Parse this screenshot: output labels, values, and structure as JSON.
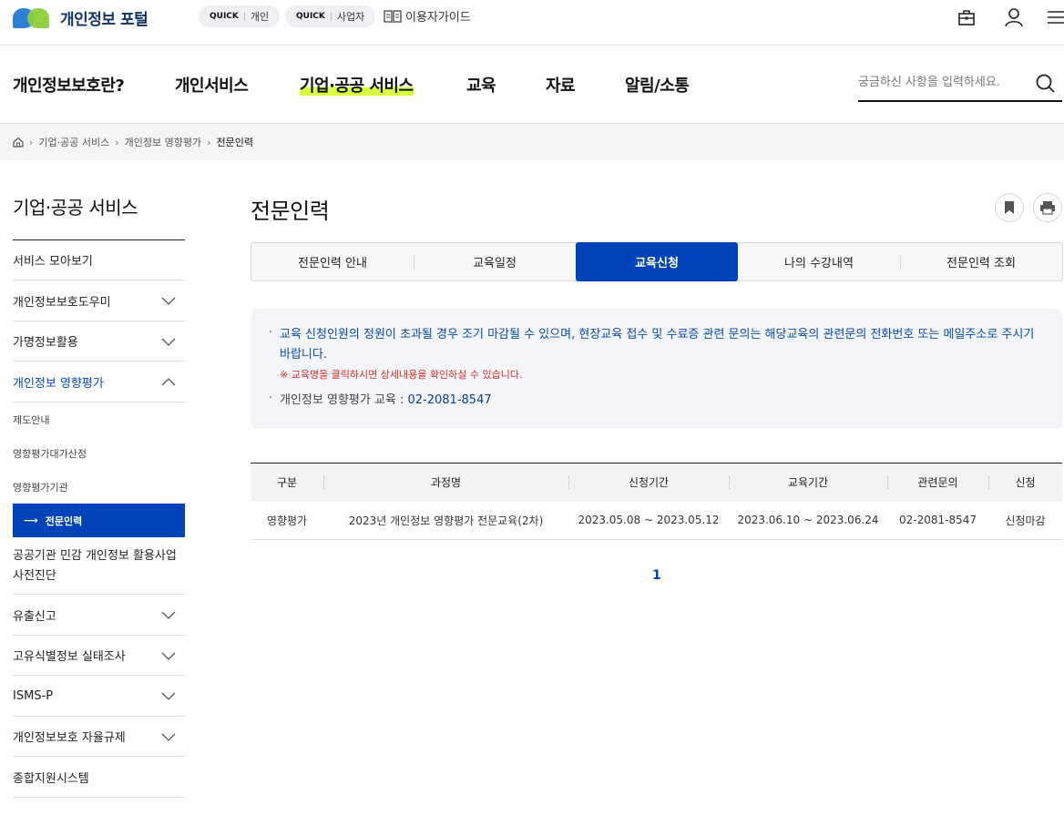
{
  "header": {
    "logo_text": "개인정보 포털",
    "quick_personal": {
      "tag": "QUICK",
      "label": "개인"
    },
    "quick_business": {
      "tag": "QUICK",
      "label": "사업자"
    },
    "guide_label": "이용자가이드",
    "icons": [
      "bag-icon",
      "user-icon",
      "menu-icon"
    ]
  },
  "gnb": {
    "items": [
      "개인정보보호란?",
      "개인서비스",
      "기업·공공 서비스",
      "교육",
      "자료",
      "알림/소통"
    ],
    "active_index": 2,
    "search_placeholder": "궁금하신 사항을 입력하세요."
  },
  "breadcrumb": [
    "기업·공공 서비스",
    "개인정보 영향평가",
    "전문인력"
  ],
  "sidebar": {
    "title": "기업·공공 서비스",
    "items": [
      {
        "label": "서비스 모아보기"
      },
      {
        "label": "개인정보보호도우미"
      },
      {
        "label": "가명정보활용"
      },
      {
        "label": "개인정보 영향평가"
      },
      {
        "label": "공공기관 민감 개인정보 활용사업 사전진단"
      },
      {
        "label": "유출신고"
      },
      {
        "label": "고유식별정보 실태조사"
      },
      {
        "label": "ISMS-P"
      },
      {
        "label": "개인정보보호 자율규제"
      },
      {
        "label": "종합지원시스템"
      }
    ],
    "sub_items": [
      "제도안내",
      "영향평가대가산정",
      "영향평가기관",
      "전문인력"
    ],
    "active_sub_arrow": "⟶"
  },
  "main": {
    "title": "전문인력",
    "tabs": [
      "전문인력 안내",
      "교육일정",
      "교육신청",
      "나의 수강내역",
      "전문인력 조회"
    ],
    "active_tab": 2,
    "notice": {
      "line1": "교육 신청인원의 정원이 초과될 경우 조기 마감될 수 있으며, 현장교육 접수 및 수료증 관련 문의는 해당교육의 관련문의 전화번호 또는 메일주소로 주시기 바랍니다.",
      "warning": "※ 교육명을 클릭하시면 상세내용을 확인하실 수 있습니다.",
      "contact_label": "개인정보 영향평가 교육 : ",
      "contact_number": "02-2081-8547"
    },
    "table": {
      "headers": [
        "구분",
        "과정명",
        "신청기간",
        "교육기간",
        "관련문의",
        "신청"
      ],
      "rows": [
        [
          "영향평가",
          "2023년 개인정보 영향평가 전문교육(2차)",
          "2023.05.08 ~ 2023.05.12",
          "2023.06.10 ~ 2023.06.24",
          "02-2081-8547",
          "신청마감"
        ]
      ]
    },
    "pagination": {
      "current": "1"
    }
  },
  "colors": {
    "primary": "#0042b8",
    "highlight": "#d7ff3f",
    "warning": "#d9302c"
  }
}
